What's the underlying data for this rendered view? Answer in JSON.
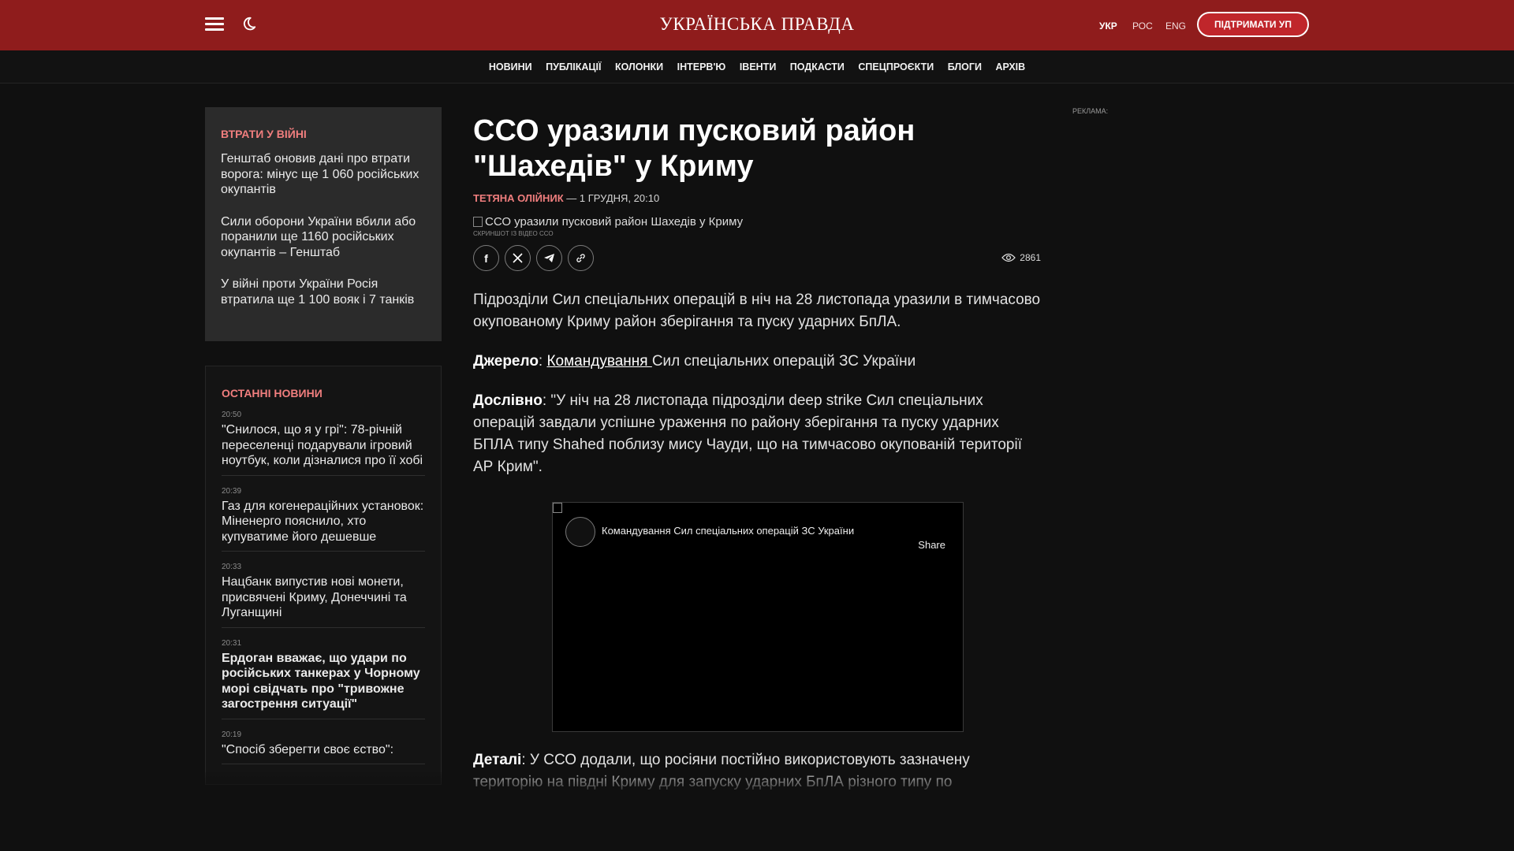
{
  "header": {
    "logo": "УКРАЇНСЬКА ПРАВДА",
    "languages": [
      "УКР",
      "РОС",
      "ENG"
    ],
    "support_label": "ПІДТРИМАТИ УП",
    "accent_color": "#8f1c1c"
  },
  "nav": {
    "items": [
      "НОВИНИ",
      "ПУБЛІКАЦІЇ",
      "КОЛОНКИ",
      "ІНТЕРВ'Ю",
      "ІВЕНТИ",
      "ПОДКАСТИ",
      "СПЕЦПРОЄКТИ",
      "БЛОГИ",
      "АРХІВ"
    ]
  },
  "sidebar": {
    "losses": {
      "title": "ВТРАТИ У ВІЙНІ",
      "items": [
        "Генштаб оновив дані про втрати ворога: мінус ще 1 060 російських окупантів",
        "Сили оборони України вбили або поранили ще 1160 російських окупантів – Генштаб",
        "У війні проти України Росія втратила ще 1 100 вояк і 7 танків"
      ]
    },
    "latest": {
      "title": "ОСТАННІ НОВИНИ",
      "items": [
        {
          "time": "20:50",
          "title": "\"Снилося, що я у грі\": 78-річній переселенці подарували ігровий ноутбук, коли дізналися про її хобі",
          "bold": false
        },
        {
          "time": "20:39",
          "title": "Газ для когенераційних установок: Міненерго пояснило, хто купуватиме його дешевше",
          "bold": false
        },
        {
          "time": "20:33",
          "title": "Нацбанк випустив нові монети, присвячені Криму, Донеччині та Луганщині",
          "bold": false
        },
        {
          "time": "20:31",
          "title": "Ердоган вважає, що удари по російських танкерах у Чорному морі свідчать про \"тривожне загострення ситуації\"",
          "bold": true
        },
        {
          "time": "20:19",
          "title": "\"Спосіб зберегти своє єство\":",
          "bold": false
        }
      ]
    }
  },
  "article": {
    "title": "ССО уразили пусковий район \"Шахедів\" у Криму",
    "author": "ТЕТЯНА ОЛІЙНИК",
    "date": "— 1 ГРУДНЯ, 20:10",
    "image_alt": "ССО уразили пусковий район Шахедів у Криму",
    "image_caption": "СКРИНШОТ ІЗ ВІДЕО ССО",
    "share_icons": [
      "facebook-icon",
      "x-icon",
      "telegram-icon",
      "link-icon"
    ],
    "views": "2861",
    "p1": "Підрозділи Сил спеціальних операцій в ніч на 28 листопада уразили в тимчасово окупованому Криму район зберігання та пуску ударних БпЛА.",
    "source_label": "Джерело",
    "source_link": "Командування ",
    "source_rest": "Сил спеціальних операцій ЗС України",
    "quote_label": "Дослівно",
    "quote_text": ": \"У ніч на 28 листопада підрозділи deep strike Сил спеціальних операцій завдали успішне ураження по району зберігання та пуску ударних БПЛА типу Shahed поблизу мису Чауди, що на тимчасово окупованій території АР Крим\".",
    "embed_channel": "Командування Сил спеціальних операцій ЗС України",
    "embed_share": "Share",
    "details_label": "Деталі",
    "details_text": ": У ССО додали, що росіяни постійно використовують зазначену територію на півдні Криму для запуску ударних БпЛА різного типу по"
  },
  "ad": {
    "label": "РЕКЛАМА:"
  }
}
